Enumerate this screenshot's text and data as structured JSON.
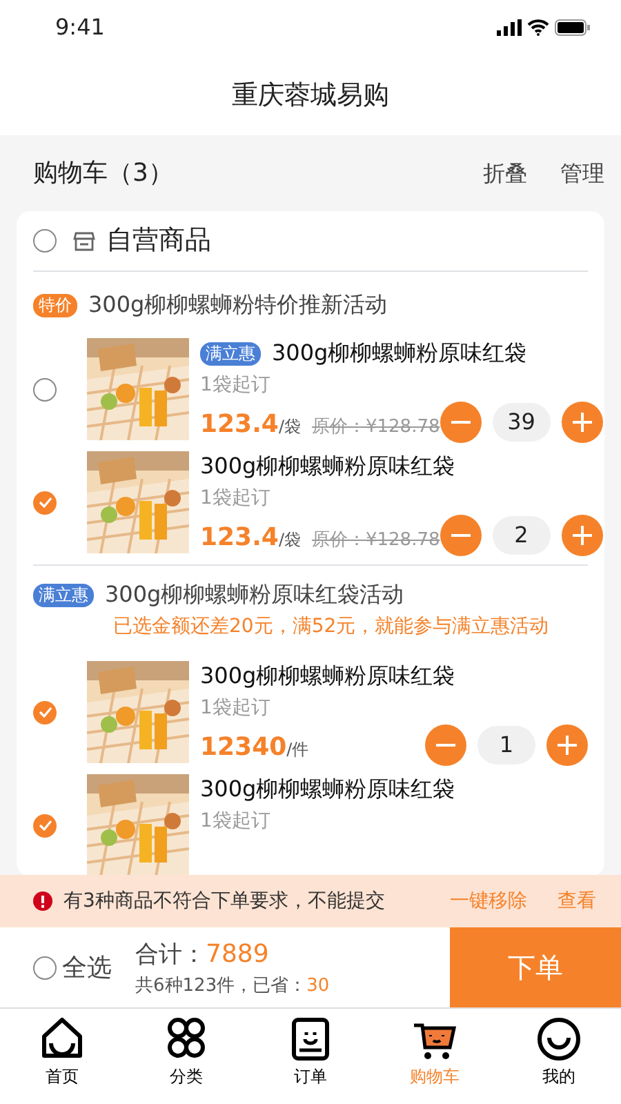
{
  "status_bar": {
    "time": "9:41"
  },
  "title": "重庆蓉城易购",
  "cart_header": {
    "title": "购物车（3）",
    "actions": [
      "折叠",
      "管理"
    ]
  },
  "shop": {
    "name": "自营商品",
    "checked": false
  },
  "groups": [
    {
      "tag": "特价",
      "kind": "special",
      "title": "300g柳柳螺蛳粉特价推新活动",
      "items": [
        {
          "tag": "满立惠",
          "name": "300g柳柳螺蛳粉原味红袋",
          "min": "1袋起订",
          "price": "123.4",
          "unit": "/袋",
          "original_price": "原价：¥128.78",
          "qty": "39",
          "checked": false
        },
        {
          "name": "300g柳柳螺蛳粉原味红袋",
          "min": "1袋起订",
          "price": "123.4",
          "unit": "/袋",
          "original_price": "原价：¥128.78",
          "qty": "2",
          "checked": true
        }
      ]
    },
    {
      "tag": "满立惠",
      "kind": "discount",
      "title": "300g柳柳螺蛳粉原味红袋活动",
      "notice": "已选金额还差20元，满52元，就能参与满立惠活动",
      "items": [
        {
          "name": "300g柳柳螺蛳粉原味红袋",
          "min": "1袋起订",
          "price": "12340",
          "unit": "/件",
          "qty": "1",
          "checked": true
        },
        {
          "name": "300g柳柳螺蛳粉原味红袋",
          "min": "1袋起订",
          "checked": true
        }
      ]
    }
  ],
  "warning": {
    "text": "有3种商品不符合下单要求，不能提交",
    "actions": [
      "一键移除",
      "查看"
    ]
  },
  "footer": {
    "select_all": "全选",
    "select_all_checked": false,
    "total_label": "合计：",
    "total": "7889",
    "summary": "共6种123件，已省：",
    "saved": "30",
    "submit": "下单"
  },
  "tabs": [
    {
      "label": "首页",
      "selected": false
    },
    {
      "label": "分类",
      "selected": false
    },
    {
      "label": "订单",
      "selected": false
    },
    {
      "label": "购物车",
      "selected": true
    },
    {
      "label": "我的",
      "selected": false
    }
  ]
}
